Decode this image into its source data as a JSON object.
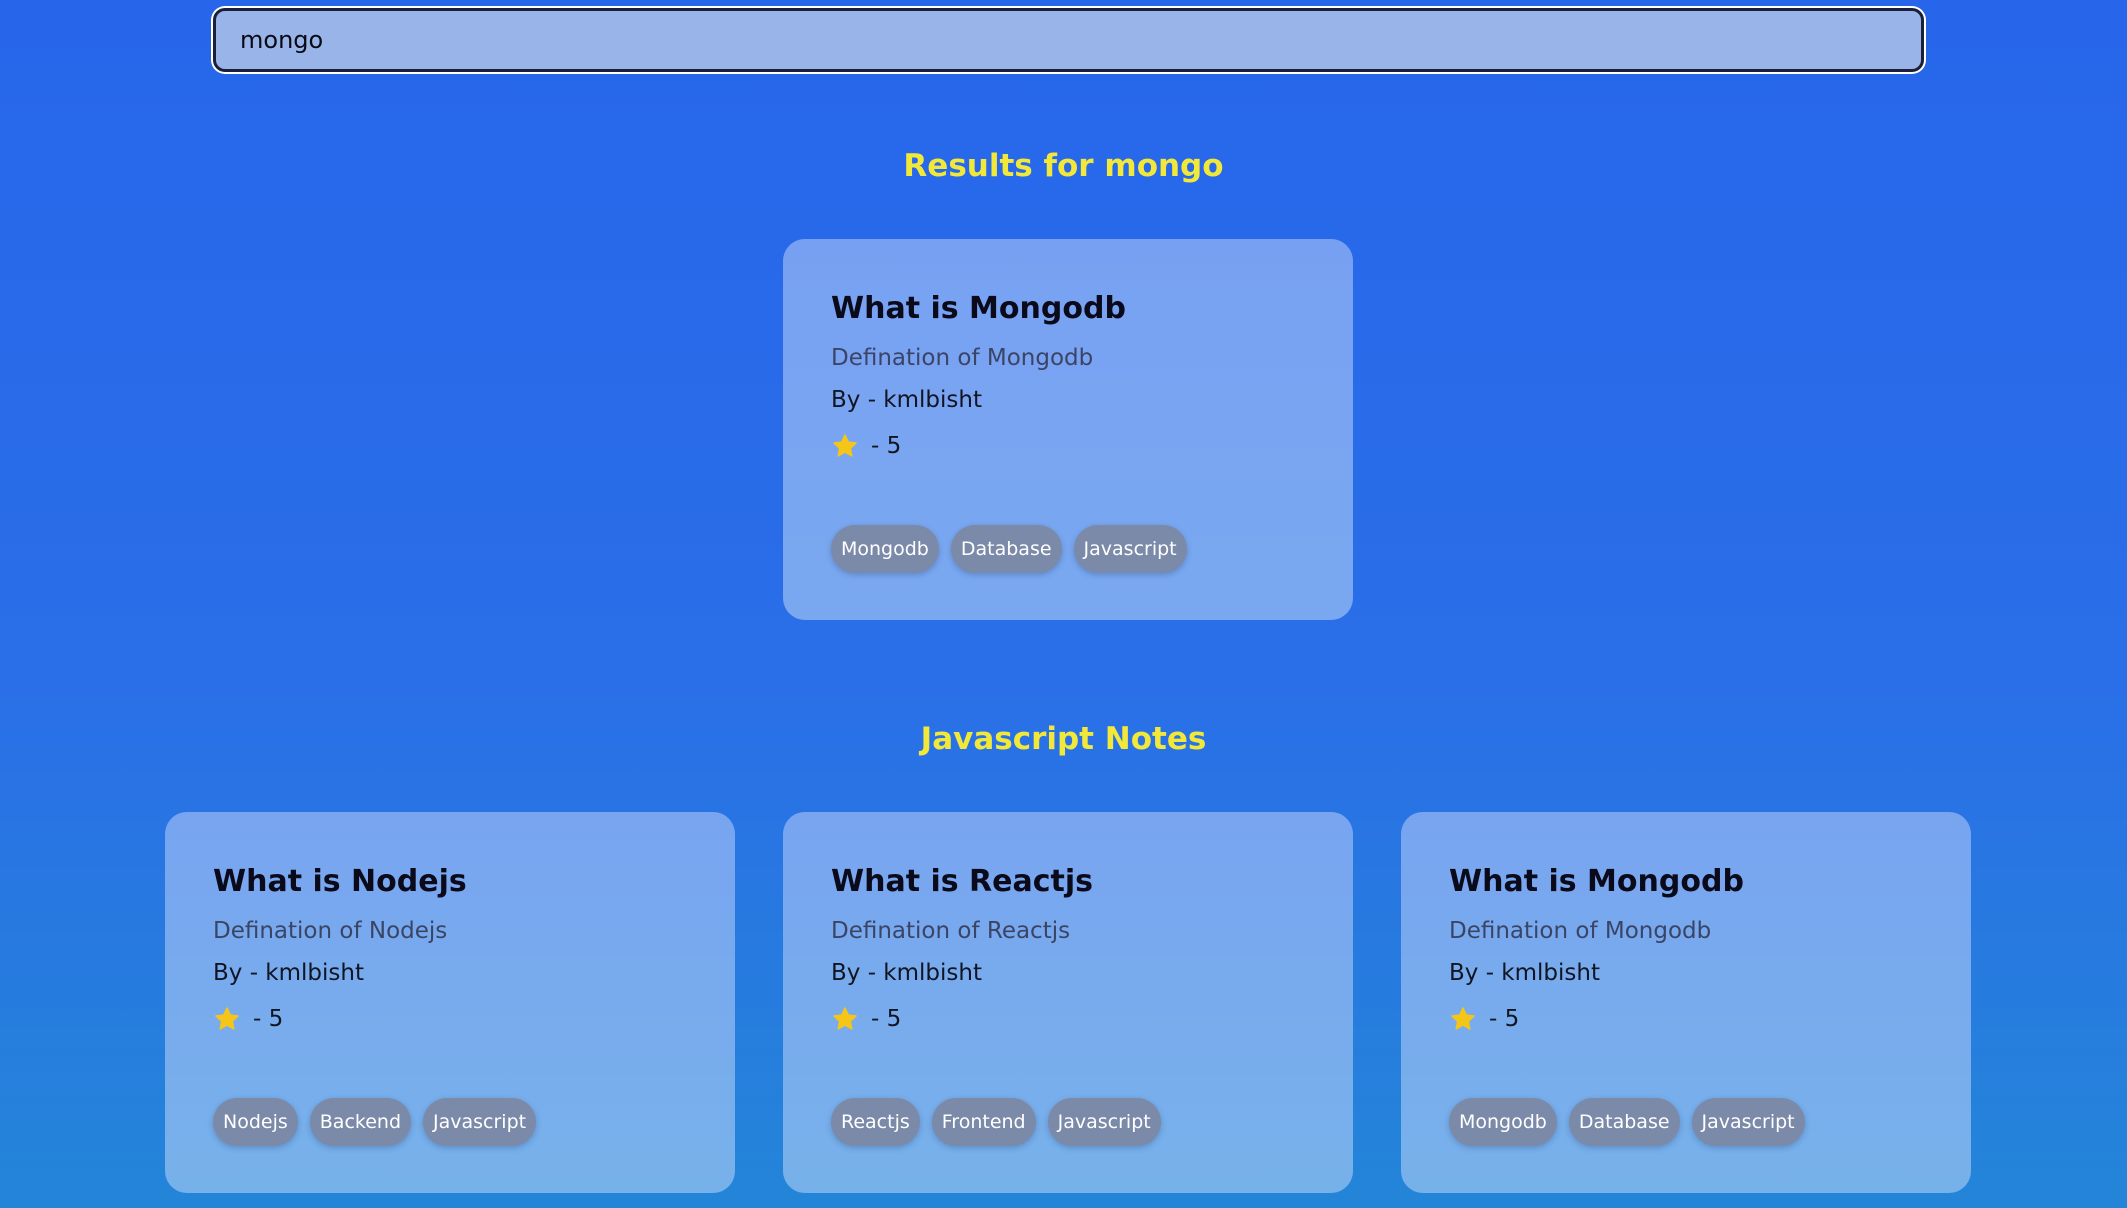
{
  "search": {
    "value": "mongo"
  },
  "results": {
    "heading": "Results for mongo",
    "cards": [
      {
        "title": "What is Mongodb",
        "description": "Defination of Mongodb",
        "author": "By - kmlbisht",
        "rating": "- 5",
        "tags": [
          "Mongodb",
          "Database",
          "Javascript"
        ]
      }
    ]
  },
  "notes": {
    "heading": "Javascript Notes",
    "cards": [
      {
        "title": "What is Nodejs",
        "description": "Defination of Nodejs",
        "author": "By - kmlbisht",
        "rating": "- 5",
        "tags": [
          "Nodejs",
          "Backend",
          "Javascript"
        ]
      },
      {
        "title": "What is Reactjs",
        "description": "Defination of Reactjs",
        "author": "By - kmlbisht",
        "rating": "- 5",
        "tags": [
          "Reactjs",
          "Frontend",
          "Javascript"
        ]
      },
      {
        "title": "What is Mongodb",
        "description": "Defination of Mongodb",
        "author": "By - kmlbisht",
        "rating": "- 5",
        "tags": [
          "Mongodb",
          "Database",
          "Javascript"
        ]
      }
    ]
  },
  "icons": {
    "rating": "star-icon"
  },
  "colors": {
    "heading": "#f2e83a",
    "star": "#f5c518",
    "tag_background": "#7b8aa8"
  }
}
